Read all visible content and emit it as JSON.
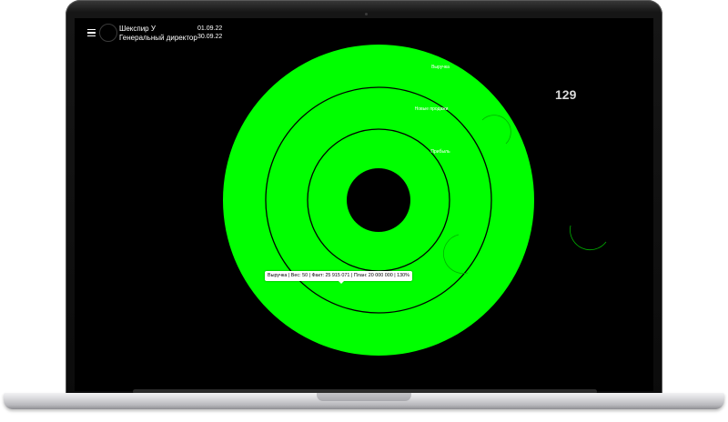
{
  "header": {
    "menu_icon": "menu-icon",
    "user_name": "Шекспир У",
    "user_role": "Генеральный директор",
    "date_from": "01.09.22",
    "date_to": "30.09.22"
  },
  "counter": "129",
  "chart": {
    "ring_color": "#00ff00",
    "background": "#000000",
    "rings": [
      {
        "label": "Выручка"
      },
      {
        "label": "Новые продажи"
      },
      {
        "label": "Прибыль"
      }
    ],
    "tooltip": "Выручка | Вес: 50 | Факт: 25 915 071 | План: 20 000 000 | 130%"
  },
  "colors": {
    "accent": "#00ff00",
    "screen": "#000000",
    "text": "#ffffff"
  }
}
